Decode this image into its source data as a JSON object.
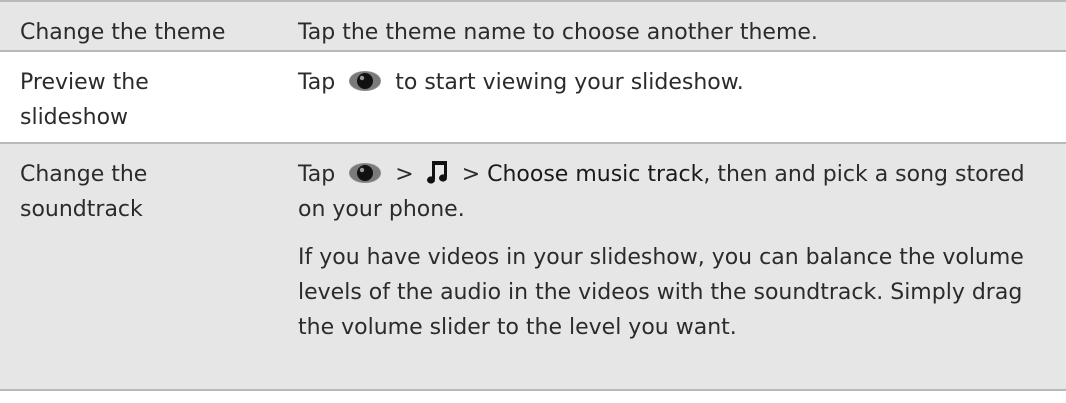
{
  "rows": [
    {
      "label": "Change the theme",
      "text": "Tap the theme name to choose another theme."
    },
    {
      "label_line1": "Preview the",
      "label_line2": "slideshow",
      "prefix": "Tap",
      "icon": "eye-icon",
      "suffix": "to start viewing your slideshow."
    },
    {
      "label_line1": "Change the",
      "label_line2": "soundtrack",
      "prefix": "Tap",
      "icon1": "eye-icon",
      "sep1": ">",
      "icon2": "music-note-icon",
      "sep2": ">",
      "menu_item": "Choose music track",
      "after_menu": ", then and pick a song stored on your phone.",
      "paragraph2": "If you have videos in your slideshow, you can balance the volume levels of the audio in the videos with the soundtrack. Simply drag the volume slider to the level you want."
    }
  ],
  "colors": {
    "row_shade": "#e6e6e6",
    "divider": "#b9b9b9",
    "text": "#2b2b2b"
  }
}
